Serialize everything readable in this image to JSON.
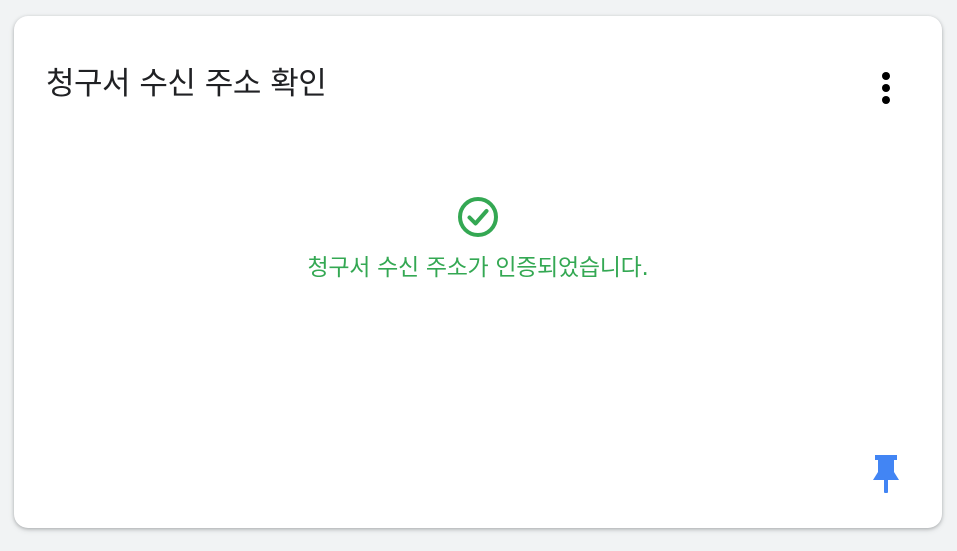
{
  "card": {
    "title": "청구서 수신 주소 확인",
    "status_message": "청구서 수신 주소가 인증되었습니다."
  },
  "icons": {
    "menu": "more-vert-icon",
    "status": "check-circle-icon",
    "pin": "push-pin-icon"
  },
  "colors": {
    "success": "#34a853",
    "pin": "#4285f4",
    "title": "#202124"
  }
}
